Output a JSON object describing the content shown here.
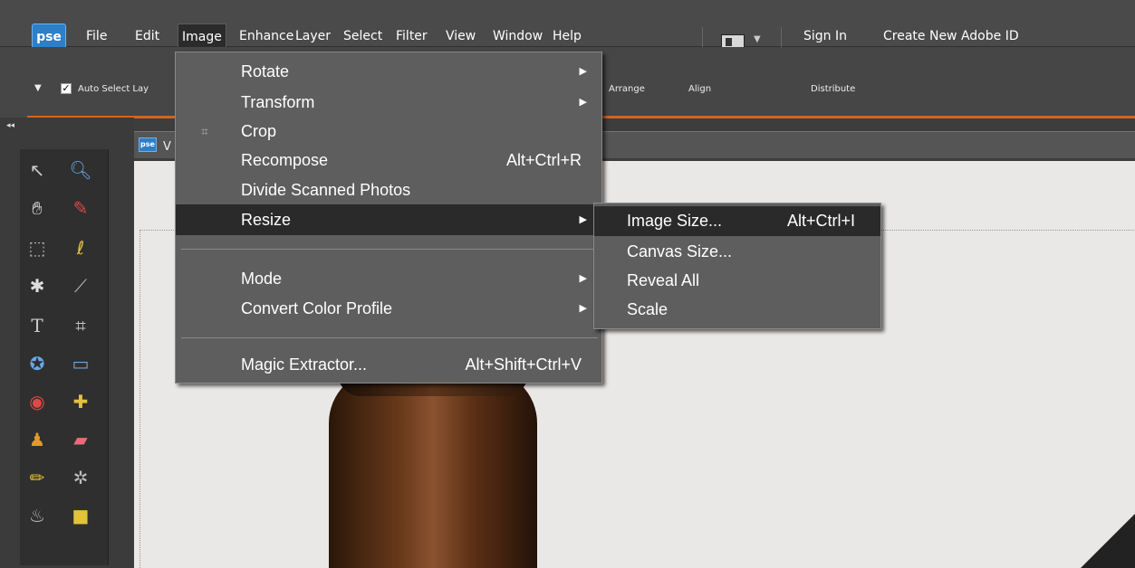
{
  "app": {
    "logo": "pse"
  },
  "menubar": {
    "items": [
      "File",
      "Edit",
      "Image",
      "Enhance",
      "Layer",
      "Select",
      "Filter",
      "View",
      "Window",
      "Help"
    ],
    "sign_in": "Sign In",
    "create_id": "Create New Adobe ID"
  },
  "options": {
    "auto_select": "Auto Select Lay",
    "arrange": "Arrange",
    "align": "Align",
    "distribute": "Distribute"
  },
  "document": {
    "title_initial": "V"
  },
  "image_menu": {
    "rotate": "Rotate",
    "transform": "Transform",
    "crop": "Crop",
    "recompose": "Recompose",
    "recompose_shortcut": "Alt+Ctrl+R",
    "divide": "Divide Scanned Photos",
    "resize": "Resize",
    "mode": "Mode",
    "convert": "Convert Color Profile",
    "magic": "Magic Extractor...",
    "magic_shortcut": "Alt+Shift+Ctrl+V"
  },
  "resize_menu": {
    "image_size": "Image Size...",
    "image_size_shortcut": "Alt+Ctrl+I",
    "canvas_size": "Canvas Size...",
    "reveal_all": "Reveal All",
    "scale": "Scale"
  },
  "colors": {
    "accent": "#d3641d",
    "logo_blue": "#2d7fc7",
    "highlight": "#2a2a2a"
  }
}
